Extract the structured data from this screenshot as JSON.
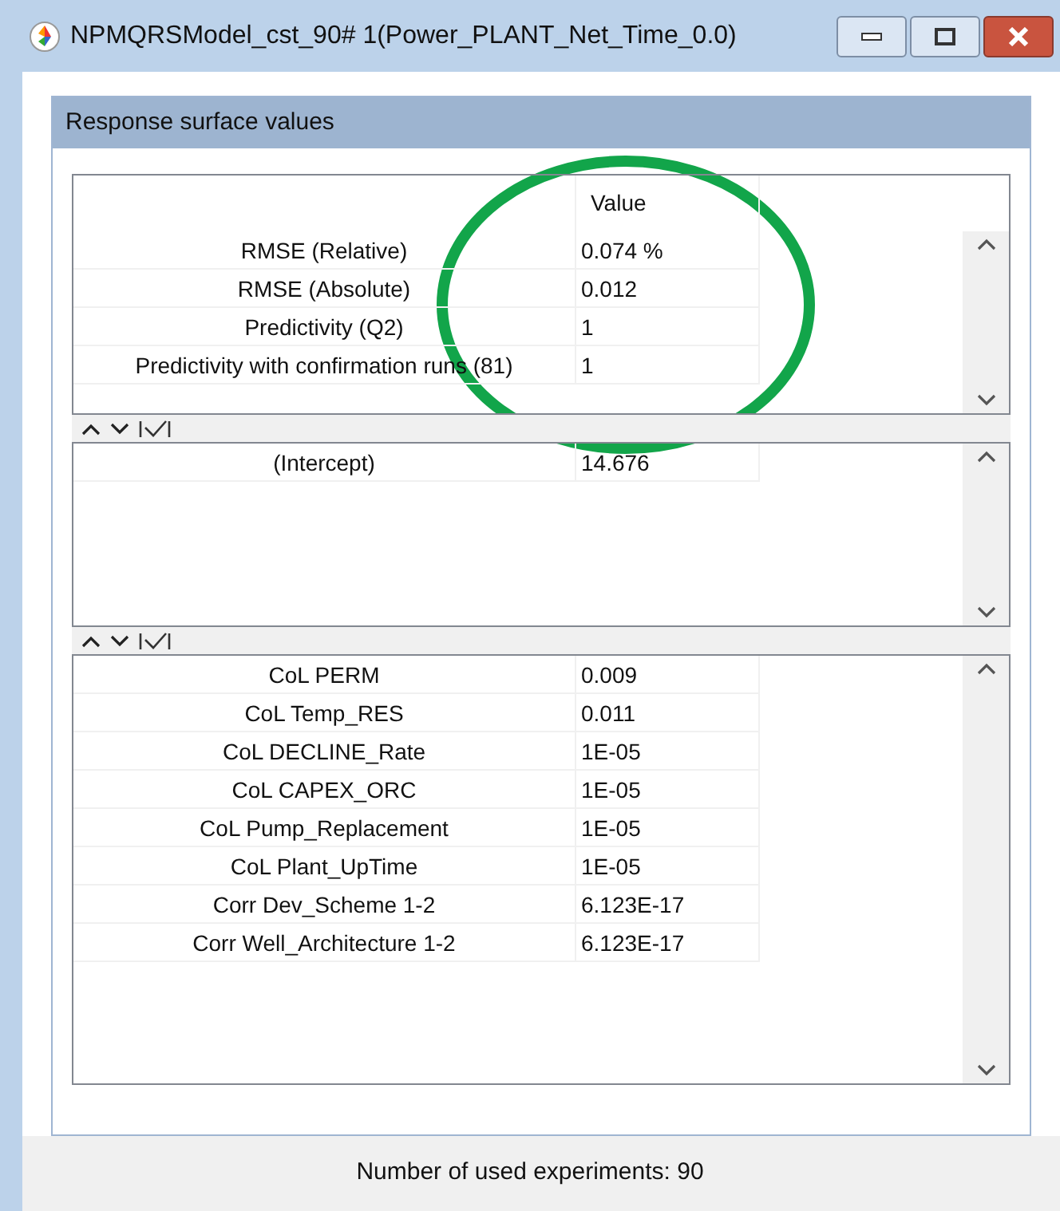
{
  "window": {
    "title": "NPMQRSModel_cst_90# 1(Power_PLANT_Net_Time_0.0)"
  },
  "panel": {
    "title": "Response surface values"
  },
  "tables": [
    {
      "header": "Value",
      "rows": [
        {
          "name": "RMSE (Relative)",
          "value": "0.074 %"
        },
        {
          "name": "RMSE (Absolute)",
          "value": "0.012"
        },
        {
          "name": "Predictivity (Q2)",
          "value": "1"
        },
        {
          "name": "Predictivity with confirmation runs (81)",
          "value": "1"
        }
      ]
    },
    {
      "rows": [
        {
          "name": "(Intercept)",
          "value": "14.676"
        }
      ]
    },
    {
      "rows": [
        {
          "name": "CoL PERM",
          "value": "0.009"
        },
        {
          "name": "CoL Temp_RES",
          "value": "0.011"
        },
        {
          "name": "CoL DECLINE_Rate",
          "value": "1E-05"
        },
        {
          "name": "CoL CAPEX_ORC",
          "value": "1E-05"
        },
        {
          "name": "CoL Pump_Replacement",
          "value": "1E-05"
        },
        {
          "name": "CoL Plant_UpTime",
          "value": "1E-05"
        },
        {
          "name": "Corr Dev_Scheme 1-2",
          "value": "6.123E-17"
        },
        {
          "name": "Corr Well_Architecture 1-2",
          "value": "6.123E-17"
        }
      ]
    }
  ],
  "status_bar": "Number of used experiments: 90"
}
